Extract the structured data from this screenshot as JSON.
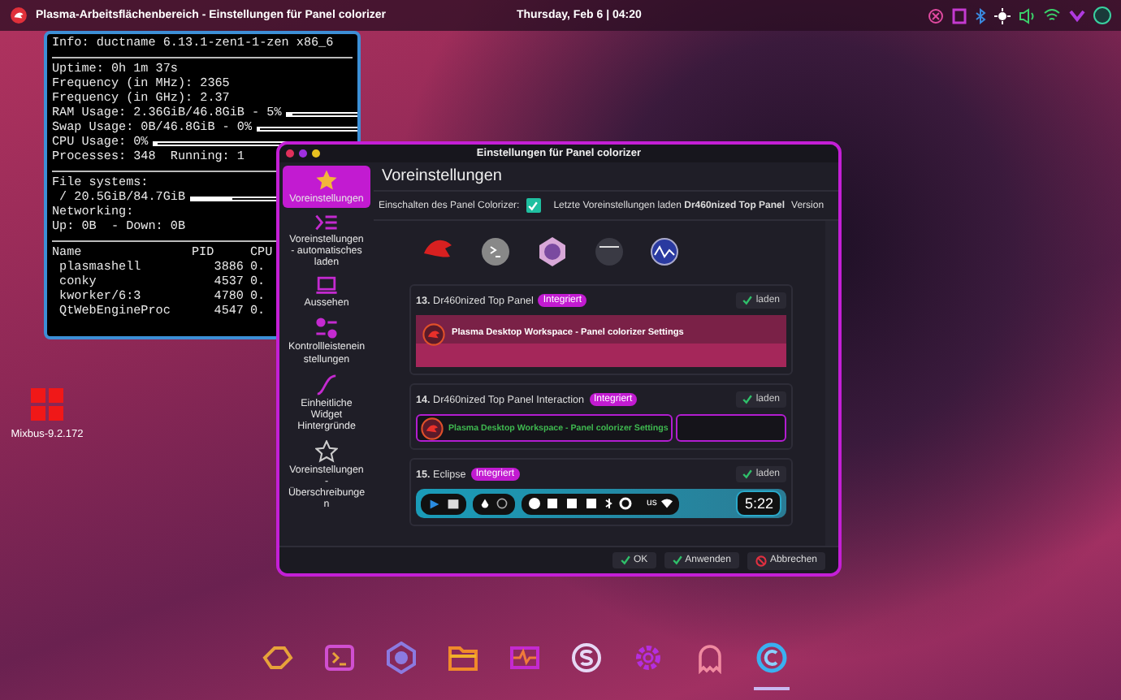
{
  "topbar": {
    "title": "Plasma-Arbeitsflächenbereich - Einstellungen für Panel colorizer",
    "clock": "Thursday, Feb 6 | 04:20"
  },
  "desktop_icon": {
    "label": "Mixbus-9.2.172"
  },
  "conky": {
    "info": "Info: ductname 6.13.1-zen1-1-zen x86_6",
    "sections": [
      [
        {
          "text": "Uptime: 0h 1m 37s"
        },
        {
          "text": "Frequency (in MHz): 2365"
        },
        {
          "text": "Frequency (in GHz): 2.37"
        },
        {
          "text": "RAM Usage: 2.36GiB/46.8GiB - 5%",
          "level": 0.05
        },
        {
          "text": "Swap Usage: 0B/46.8GiB - 0%",
          "level": 0.0
        },
        {
          "text": "CPU Usage: 0%",
          "level": 0.0
        },
        {
          "text": "Processes: 348  Running: 1"
        }
      ],
      [
        {
          "text": "File systems:"
        },
        {
          "text": " / 20.5GiB/84.7GiB",
          "level": 0.24
        },
        {
          "text": "Networking:"
        },
        {
          "text": "Up: 0B  - Down: 0B"
        }
      ]
    ],
    "columns": [
      "Name",
      "PID",
      "CPU"
    ],
    "rows": [
      [
        "plasmashell",
        "3886",
        "0."
      ],
      [
        "conky",
        "4537",
        "0."
      ],
      [
        "kworker/6:3",
        "4780",
        "0."
      ],
      [
        "QtWebEngineProc",
        "4547",
        "0."
      ]
    ]
  },
  "dialog": {
    "title": "Einstellungen für Panel colorizer",
    "sidebar": [
      {
        "label": "Voreinstellungen",
        "selected": true
      },
      {
        "label": "Voreinstellungen - automatisches laden",
        "selected": false
      },
      {
        "label": "Aussehen",
        "selected": false
      },
      {
        "label": "Kontrollleisteneinstellungen",
        "selected": false
      },
      {
        "label": "Einheitliche Widget Hintergründe",
        "selected": false
      },
      {
        "label": "Voreinstellungen - Überschreibungen",
        "selected": false
      }
    ],
    "heading": "Voreinstellungen",
    "enable_label": "Einschalten des Panel Colorizer:",
    "enabled": true,
    "last_label": "Letzte Voreinstellungen laden",
    "last_value": "Dr460nized Top Panel",
    "version_label": "Version",
    "presets": [
      {
        "number": "13.",
        "name": "Dr460nized Top Panel",
        "badge": "Integriert",
        "button": "laden",
        "kind": "banner",
        "preview_text": "Plasma Desktop Workspace - Panel colorizer Settings"
      },
      {
        "number": "14.",
        "name": "Dr460nized Top Panel Interaction",
        "badge": "Integriert",
        "button": "laden",
        "kind": "outlined",
        "preview_text": "Plasma Desktop Workspace - Panel colorizer Settings"
      },
      {
        "number": "15.",
        "name": "Eclipse",
        "badge": "Integriert",
        "button": "laden",
        "kind": "dock",
        "preview_text": "us",
        "clock": "5:22"
      }
    ],
    "buttons": [
      "OK",
      "Anwenden",
      "Abbrechen"
    ]
  },
  "dock": [
    {
      "selected": false
    },
    {
      "selected": false
    },
    {
      "selected": false
    },
    {
      "selected": false
    },
    {
      "selected": false
    },
    {
      "selected": false
    },
    {
      "selected": false
    },
    {
      "selected": false
    },
    {
      "selected": true
    }
  ]
}
